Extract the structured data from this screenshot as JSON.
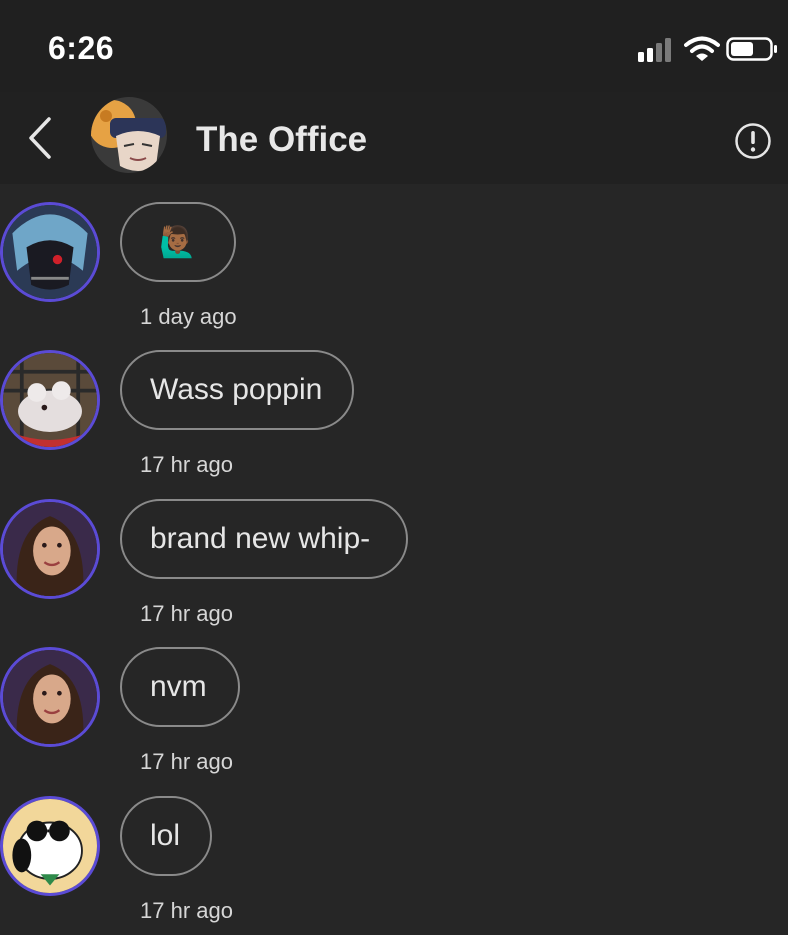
{
  "status_bar": {
    "time": "6:26",
    "icons": [
      "signal-icon",
      "wifi-icon",
      "battery-icon"
    ]
  },
  "header": {
    "title": "The Office",
    "back_icon": "chevron-left-icon",
    "info_icon": "info-icon"
  },
  "messages": [
    {
      "text": "🙋🏾‍♂️",
      "time": "1 day ago"
    },
    {
      "text": "Wass poppin",
      "time": "17 hr ago"
    },
    {
      "text": "brand new whip-",
      "time": "17 hr ago"
    },
    {
      "text": "nvm",
      "time": "17 hr ago"
    },
    {
      "text": "lol",
      "time": "17 hr ago"
    }
  ],
  "colors": {
    "background": "#262626",
    "header": "#212121",
    "avatar_ring": "#5b4bd6",
    "bubble_border": "#8a8a8a"
  }
}
